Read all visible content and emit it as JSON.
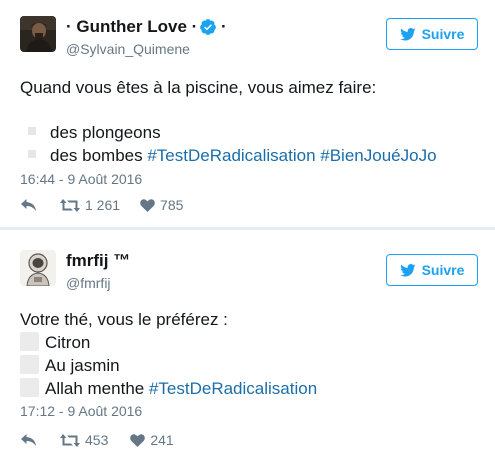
{
  "tweets": [
    {
      "display_name": "· Gunther Love ·",
      "handle": "@Sylvain_Quimene",
      "verified": true,
      "follow_label": "Suivre",
      "intro": "Quand vous êtes à la piscine, vous aimez faire:",
      "options": [
        {
          "text": "des plongeons",
          "hashtags": ""
        },
        {
          "text": "des bombes ",
          "hashtags": "#TestDeRadicalisation #BienJouéJoJo"
        }
      ],
      "timestamp": "16:44 - 9 Août 2016",
      "retweets": "1 261",
      "likes": "785"
    },
    {
      "display_name": "fmrfij ™",
      "handle": "@fmrfij",
      "verified": false,
      "follow_label": "Suivre",
      "intro": "Votre thé, vous le préférez :",
      "options": [
        {
          "text": "Citron",
          "hashtags": ""
        },
        {
          "text": "Au jasmin",
          "hashtags": ""
        },
        {
          "text": "Allah menthe ",
          "hashtags": "#TestDeRadicalisation"
        }
      ],
      "timestamp": "17:12 - 9 Août 2016",
      "retweets": "453",
      "likes": "241"
    }
  ],
  "colors": {
    "accent": "#1da1f2",
    "hashtag": "#1b6ea8",
    "muted": "#657786",
    "separator": "#e6ecf0"
  },
  "icons": [
    "avatar-photo",
    "verified-badge-icon",
    "bird-icon",
    "reply-icon",
    "retweet-icon",
    "heart-icon"
  ]
}
